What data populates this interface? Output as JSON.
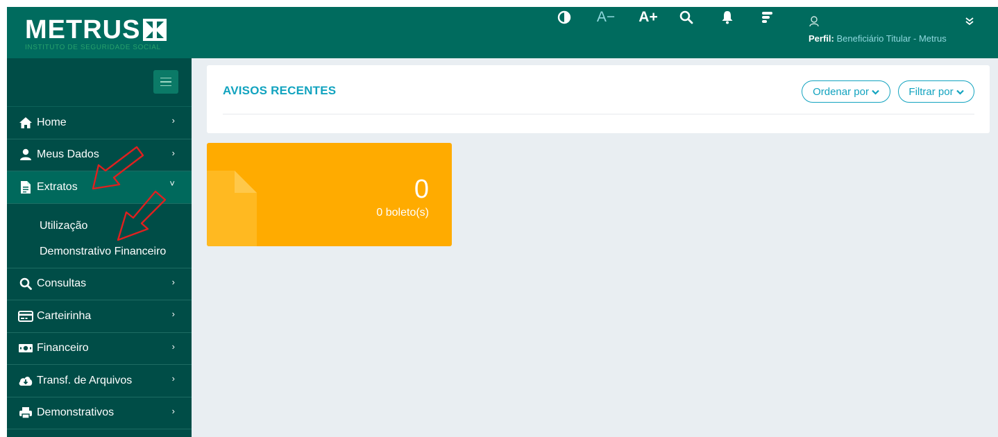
{
  "brand": {
    "name": "METRUS",
    "tagline": "INSTITUTO DE SEGURIDADE SOCIAL"
  },
  "header": {
    "tools": [
      {
        "name": "contrast-icon",
        "label": ""
      },
      {
        "name": "decrease-font",
        "label": "A−"
      },
      {
        "name": "increase-font",
        "label": "A+"
      },
      {
        "name": "search-icon",
        "label": ""
      },
      {
        "name": "bell-icon",
        "label": ""
      },
      {
        "name": "menu-lines-icon",
        "label": ""
      }
    ],
    "profile": {
      "prefix": "Perfil:",
      "value": "Beneficiário Titular - Metrus"
    }
  },
  "sidebar": {
    "items": [
      {
        "label": "Home",
        "icon": "home-icon"
      },
      {
        "label": "Meus Dados",
        "icon": "user-icon"
      },
      {
        "label": "Extratos",
        "icon": "file-icon",
        "expanded": true,
        "children": [
          {
            "label": "Utilização"
          },
          {
            "label": "Demonstrativo Financeiro"
          }
        ]
      },
      {
        "label": "Consultas",
        "icon": "search-icon"
      },
      {
        "label": "Carteirinha",
        "icon": "card-icon"
      },
      {
        "label": "Financeiro",
        "icon": "money-icon"
      },
      {
        "label": "Transf. de Arquivos",
        "icon": "cloud-download-icon"
      },
      {
        "label": "Demonstrativos",
        "icon": "print-icon"
      }
    ]
  },
  "main": {
    "avisos": {
      "title": "AVISOS RECENTES",
      "sort_label": "Ordenar por",
      "filter_label": "Filtrar por"
    },
    "tile": {
      "count": "0",
      "label": "0 boleto(s)"
    }
  },
  "colors": {
    "header": "#006b5e",
    "sidebar": "#004d47",
    "accent": "#12a3bf",
    "tile": "#ffab00"
  }
}
